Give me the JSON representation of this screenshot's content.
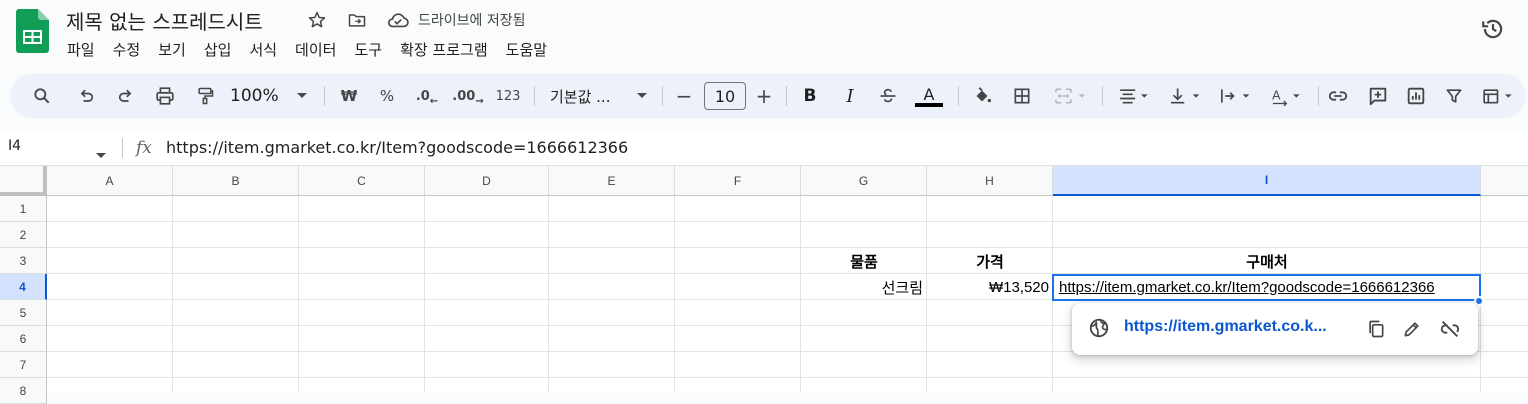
{
  "app": {
    "doc_title": "제목 없는 스프레드시트",
    "save_status": "드라이브에 저장됨",
    "brand_color": "#0f9d58",
    "accent_color": "#1a73e8"
  },
  "menu": [
    "파일",
    "수정",
    "보기",
    "삽입",
    "서식",
    "데이터",
    "도구",
    "확장 프로그램",
    "도움말"
  ],
  "toolbar": {
    "zoom": "100%",
    "currency": "₩",
    "percent": "%",
    "decrease_decimal": ".0",
    "increase_decimal": ".00",
    "more_formats": "123",
    "font_family": "기본값 ...",
    "font_size": "10",
    "minus": "−",
    "plus": "+",
    "bold": "B",
    "italic": "I",
    "text_color_letter": "A",
    "text_color_bar": "#000000",
    "icons": [
      "search-icon",
      "undo-icon",
      "redo-icon",
      "print-icon",
      "paint-format-icon",
      "bold-icon",
      "italic-icon",
      "strikethrough-icon",
      "text-color-icon",
      "fill-color-icon",
      "borders-icon",
      "merge-cells-icon",
      "horizontal-align-icon",
      "vertical-align-icon",
      "text-wrap-icon",
      "text-rotation-icon",
      "insert-link-icon",
      "insert-comment-icon",
      "insert-chart-icon",
      "filter-icon",
      "filter-views-icon"
    ]
  },
  "formula_bar": {
    "name_box": "I4",
    "fx": "fx",
    "value": "https://item.gmarket.co.kr/Item?goodscode=1666612366"
  },
  "grid": {
    "columns": [
      "A",
      "B",
      "C",
      "D",
      "E",
      "F",
      "G",
      "H",
      "I"
    ],
    "rows": [
      "1",
      "2",
      "3",
      "4",
      "5",
      "6",
      "7",
      "8"
    ],
    "active_column": "I",
    "active_row": "4",
    "cells": {
      "G3": "물품",
      "H3": "가격",
      "I3": "구매처",
      "G4": "선크림",
      "H4": "₩13,520",
      "I4": "https://item.gmarket.co.kr/Item?goodscode=1666612366"
    }
  },
  "link_popup": {
    "text": "https://item.gmarket.co.k...",
    "icons": [
      "globe-icon",
      "copy-link-icon",
      "edit-link-icon",
      "remove-link-icon"
    ]
  }
}
